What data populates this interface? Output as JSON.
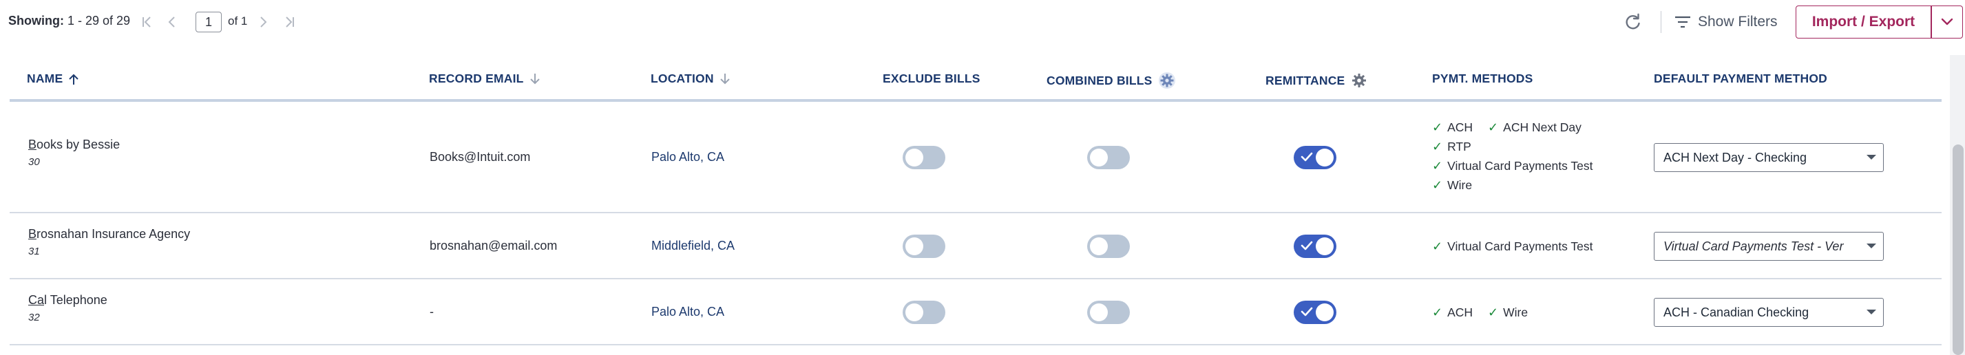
{
  "pagination": {
    "showing_label": "Showing:",
    "showing_range": "1 - 29 of 29",
    "current_page": "1",
    "of_label": "of 1"
  },
  "toolbar": {
    "show_filters_label": "Show Filters",
    "import_export_label": "Import / Export"
  },
  "columns": {
    "name": "NAME",
    "record_email": "RECORD EMAIL",
    "location": "LOCATION",
    "exclude_bills": "EXCLUDE BILLS",
    "combined_bills": "COMBINED BILLS",
    "remittance": "REMITTANCE",
    "pymt_methods": "PYMT. METHODS",
    "default_payment_method": "DEFAULT PAYMENT METHOD"
  },
  "rows": [
    {
      "name_first_letter": "B",
      "name_rest": "ooks by Bessie",
      "number": "30",
      "email": "Books@Intuit.com",
      "location": "Palo Alto, CA",
      "exclude_bills": false,
      "combined_bills": false,
      "remittance": true,
      "methods": [
        "ACH",
        "ACH Next Day",
        "RTP",
        "Virtual Card Payments Test",
        "Wire"
      ],
      "default_method": "ACH Next Day - Checking"
    },
    {
      "name_first_letter": "B",
      "name_rest": "rosnahan Insurance Agency",
      "number": "31",
      "email": "brosnahan@email.com",
      "location": "Middlefield, CA",
      "exclude_bills": false,
      "combined_bills": false,
      "remittance": true,
      "methods": [
        "Virtual Card Payments Test"
      ],
      "default_method": "Virtual Card Payments Test - Ver"
    },
    {
      "name_first_letter": "Ca",
      "name_rest": "l Telephone",
      "number": "32",
      "email": "-",
      "location": "Palo Alto, CA",
      "exclude_bills": false,
      "combined_bills": false,
      "remittance": true,
      "methods": [
        "ACH",
        "Wire"
      ],
      "default_method": "ACH - Canadian Checking"
    }
  ],
  "colors": {
    "header_text": "#1d3a6e",
    "brand_button": "#a3275d",
    "toggle_on": "#3b5ec2",
    "toggle_off": "#b9c6d6",
    "check": "#1c8a3a"
  }
}
